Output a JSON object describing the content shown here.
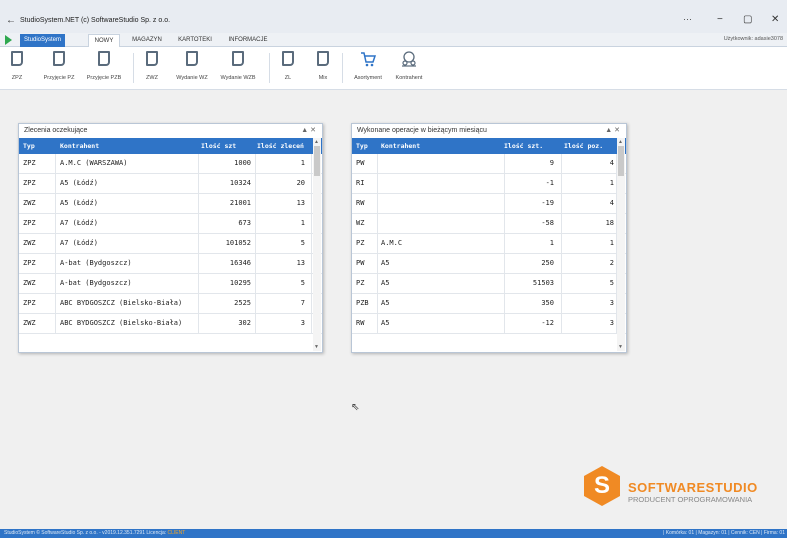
{
  "window": {
    "title": "StudioSystem.NET (c) SoftwareStudio Sp. z o.o.",
    "back": "←",
    "more": "···",
    "minimize": "−",
    "maximize": "▢",
    "close": "✕"
  },
  "tabs": {
    "studio": "StudioSystem",
    "nowy": "NOWY",
    "magazyn": "MAGAZYN",
    "kartoteki": "KARTOTEKI",
    "informacje": "INFORMACJE",
    "user": "Użytkownik: adasie3078"
  },
  "ribbon": {
    "zpz": "ZPZ",
    "przyjecie_pz": "Przyjęcie PZ",
    "przyjecie_pzb": "Przyjęcie PZB",
    "zwz": "ZWZ",
    "wydanie_wz": "Wydanie WZ",
    "wydanie_wzb": "Wydanie WZB",
    "zl": "ZL",
    "mix": "Mix",
    "asortyment": "Asortyment",
    "kontrahent": "Kontrahent"
  },
  "panel_left": {
    "title": "Zlecenia oczekujące",
    "controls": "▲ ✕",
    "headers": [
      "Typ",
      "Kontrahent",
      "Ilość szt",
      "Ilość zleceń"
    ],
    "rows": [
      [
        "ZPZ",
        "A.M.C (WARSZAWA)",
        "1000",
        "1"
      ],
      [
        "ZPZ",
        "A5 (Łódź)",
        "10324",
        "20"
      ],
      [
        "ZWZ",
        "A5 (Łódź)",
        "21001",
        "13"
      ],
      [
        "ZPZ",
        "A7 (Łódź)",
        "673",
        "1"
      ],
      [
        "ZWZ",
        "A7 (Łódź)",
        "101052",
        "5"
      ],
      [
        "ZPZ",
        "A-bat (Bydgoszcz)",
        "16346",
        "13"
      ],
      [
        "ZWZ",
        "A-bat (Bydgoszcz)",
        "10295",
        "5"
      ],
      [
        "ZPZ",
        "ABC BYDGOSZCZ (Bielsko-Biała)",
        "2525",
        "7"
      ],
      [
        "ZWZ",
        "ABC BYDGOSZCZ (Bielsko-Biała)",
        "302",
        "3"
      ]
    ]
  },
  "panel_right": {
    "title": "Wykonane operacje w bieżącym miesiącu",
    "controls": "▲ ✕",
    "headers": [
      "Typ",
      "Kontrahent",
      "Ilość szt.",
      "Ilość poz."
    ],
    "rows": [
      [
        "PW",
        "",
        "9",
        "4"
      ],
      [
        "RI",
        "",
        "-1",
        "1"
      ],
      [
        "RW",
        "",
        "-19",
        "4"
      ],
      [
        "WZ",
        "",
        "-58",
        "18"
      ],
      [
        "PZ",
        "A.M.C",
        "1",
        "1"
      ],
      [
        "PW",
        "A5",
        "250",
        "2"
      ],
      [
        "PZ",
        "A5",
        "51503",
        "5"
      ],
      [
        "PZB",
        "A5",
        "350",
        "3"
      ],
      [
        "RW",
        "A5",
        "-12",
        "3"
      ]
    ]
  },
  "logo": {
    "letter": "S",
    "brand": "SOFTWARESTUDIO",
    "tagline": "PRODUCENT OPROGRAMOWANIA"
  },
  "status": {
    "left": "StudioSystem © SoftwareStudio Sp. z o.o. - v2019.12.351.7291",
    "license_label": "Licencja:",
    "license_value": "CLIENT",
    "right": "| Komórka: 01 | Magazyn: 01 | Cennik: CEN | Firma: 01"
  }
}
